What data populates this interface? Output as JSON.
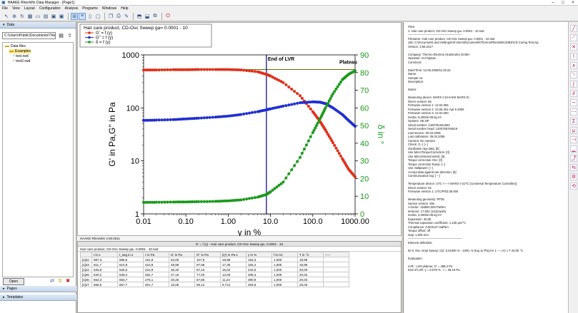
{
  "window": {
    "title": "HAAKE RheoWin Data Manager - [Page1]"
  },
  "menu": [
    "File",
    "View",
    "Layout",
    "Configuration",
    "Analysis",
    "Programs",
    "Windows",
    "Help"
  ],
  "left": {
    "data_header": "Data",
    "path": "C:\\Users\\Public\\Documents\\Thermo\\",
    "tree": [
      "Data files",
      "Examples",
      "test.rwd",
      "test2.rwd"
    ],
    "open_label": "Open",
    "pages_header": "Pages",
    "templates_header": "Templates"
  },
  "chart": {
    "window_title": "Hair care product, CD-Osc Sweep ga= 0.0001 - 10",
    "legend": [
      "G' = f (γ)",
      "G'' = f (γ)",
      "δ = f (γ)"
    ],
    "annotations": {
      "lvr": "End of LVR",
      "plateau": "Plateau"
    },
    "colors": {
      "g1": "#e0301a",
      "g2": "#1f2fd0",
      "delta": "#1a9a1a",
      "lvr": "#000080",
      "plateau": "#6b6b00"
    }
  },
  "chart_data": {
    "type": "scatter",
    "xlabel": "γ in %",
    "ylabel": "G' in Pa,G'' in Pa",
    "y2label": "δ in °",
    "xscale": "log",
    "yscale": "log",
    "xlim": [
      0.01,
      1000
    ],
    "ylim": [
      1,
      1000
    ],
    "y2lim": [
      0,
      90
    ],
    "xticks": [
      "0.01",
      "0.10",
      "1.00",
      "10.0",
      "100.0",
      "1000.00"
    ],
    "yticks": [
      "1",
      "10",
      "100",
      "1000"
    ],
    "y2ticks": [
      "0",
      "10",
      "20",
      "30",
      "40",
      "50",
      "60",
      "70",
      "80",
      "90"
    ],
    "vline_x": 8.0,
    "hline_y": 530,
    "series": [
      {
        "name": "G' = f (γ)",
        "x": [
          0.01,
          0.02,
          0.05,
          0.1,
          0.2,
          0.5,
          1,
          2,
          5,
          8,
          10,
          20,
          50,
          100,
          150,
          200,
          300,
          500,
          700,
          1000
        ],
        "y": [
          520,
          520,
          525,
          525,
          530,
          530,
          530,
          520,
          480,
          430,
          400,
          300,
          170,
          85,
          55,
          38,
          22,
          11,
          7,
          5
        ]
      },
      {
        "name": "G'' = f (γ)",
        "x": [
          0.01,
          0.02,
          0.05,
          0.1,
          0.2,
          0.5,
          1,
          2,
          5,
          8,
          10,
          20,
          50,
          100,
          150,
          200,
          300,
          500,
          700,
          1000
        ],
        "y": [
          58,
          59,
          60,
          62,
          64,
          67,
          70,
          75,
          85,
          92,
          96,
          108,
          125,
          130,
          128,
          120,
          100,
          75,
          58,
          45
        ]
      },
      {
        "name": "δ = f (γ)",
        "x": [
          0.01,
          0.02,
          0.05,
          0.1,
          0.2,
          0.5,
          1,
          2,
          5,
          8,
          10,
          20,
          50,
          100,
          150,
          200,
          300,
          500,
          700,
          1000
        ],
        "y": [
          6.5,
          6.6,
          6.7,
          6.8,
          6.9,
          7.1,
          7.4,
          7.9,
          9.5,
          11,
          12.5,
          18,
          32,
          46,
          54,
          60,
          68,
          76,
          79,
          81
        ]
      }
    ]
  },
  "status_line": "HAAKE RheoWin 4.00.0011",
  "table": {
    "title": "G' = f (γ) - Hair care product, CD-Osc Sweep ga= 0.0001 - 10",
    "subtitle": "Hair care product, CD-Osc Sweep ga= 0.0001 - 10.rwd",
    "headers": [
      "",
      "t in s",
      "t_seg in s",
      "τ in Pa",
      "G' in Pa",
      "G'' in Pa",
      "|η*| in Pa s",
      "γ in %",
      "f in Hz",
      "T in °C",
      "-----"
    ],
    "rows": [
      [
        "[s]42",
        "987,3",
        "586,5",
        "191,9",
        "64,00",
        "107,9",
        "19,98",
        "153,3",
        "1,000",
        "19,99",
        ""
      ],
      [
        "[s]43",
        "611,7",
        "610,8",
        "210,8",
        "48,99",
        "97,58",
        "17,35",
        "183,4",
        "1,000",
        "19,99",
        ""
      ],
      [
        "[s]44",
        "625,8",
        "625,0",
        "231,9",
        "36,40",
        "87,10",
        "15,02",
        "244,6",
        "1,000",
        "20,00",
        ""
      ],
      [
        "[s]45",
        "640,2",
        "639,4",
        "252,7",
        "27,16",
        "77,00",
        "13,00",
        "309,4",
        "1,000",
        "20,02",
        ""
      ],
      [
        "[s]46",
        "654,3",
        "653,7",
        "276,1",
        "20,25",
        "67,66",
        "11,24",
        "390,9",
        "1,000",
        "20,03",
        ""
      ],
      [
        "[s]47",
        "668,6",
        "667,7",
        "301,7",
        "15,05",
        "59,14",
        "9,712",
        "494,5",
        "1,000",
        "20,03",
        ""
      ]
    ]
  },
  "info": {
    "lines": [
      "Files:",
      "1: Hair care product, CD-Osc Sweep ga= 0.0001 - 10.rwd",
      "------------------------------------------------------",
      "Filename: Hair care product, CD-Osc Sweep ga= 0.0001 - 10.rwd",
      "Job: C:\\Documents and Settings\\All Users\\Documents\\Thermo\\RheoWin\\JOBS\\CD Curing Test.rwj",
      "Version: 3.65.0417",
      "",
      "Company: Thermo Electron (Karlsruhe) GmbH",
      "Operator: Anl Nijman",
      "Comment:",
      "",
      "Date/Time: 12.06.2008/11:25:22",
      "Name:",
      "Sample no:",
      "Description:",
      "",
      "Notes:",
      "",
      "Measuring device: MARS II (HAAKE MARS II)",
      "Driver version: 56",
      "Firmware version 1: 12.04.005",
      "Firmware version 2: 10.06.401-Apr 6 2006",
      "Firmware version 3: 12.02.000",
      "Inertia: 9,2000e-06 kg·m²",
      "Options: HE,NP",
      "Serial number: 1200781621862",
      "Serial number head: 1200765764619",
      "Last service: 05.02.2008",
      "Last calibration: 05.02.2008",
      "Camera: No camera",
      "Check: G -) [--]",
      "Oscillation raw data: [0]",
      "Use MicroTorqueCorrection: [0]",
      "Use MicroStressControl: [0]",
      "Torque correction Osc: [0]",
      "Torque correction Ramp: [--]",
      "Use Hallpower: [--]",
      "Accept data against set direction: [0]",
      "Communication log: [---]",
      "",
      "Temperature device: UTC <---> MARS II (UTC (Universal Temperature Controller))",
      "Driver version: 52",
      "Firmware version 1: UTC/P/02.05.000",
      "",
      "Measuring geometry: PP35",
      "Sensor version: 30e",
      "A-factor: 118800,000 Pa/Nm",
      "M-factor: 17,502 (1/s)/(rad/s)",
      "Inertia: 2,0000e-06 kg·m²",
      "Expansion: 30,00",
      "Thermal expansion coefficient: 1,100 µm/°C",
      "Compliance: 0,003137 rad/Nm",
      "Torque offset: off",
      "Gap: 1,000 mm",
      "------------------------------------------------------",
      "Element definition:",
      "",
      "ID 6: Osc Ampl Sweep, CD: 0,01000 % - 1000, % (log 11 Pts),Hz 1 ---; Hz 1 T 20,00 °C",
      "",
      "Evaluation:",
      "",
      "LVR - LVR plateau:  G' = 498,3 Pa",
      "End of LVR:  γ = 8,079 % ;  τ = 36,16 Pa"
    ]
  }
}
